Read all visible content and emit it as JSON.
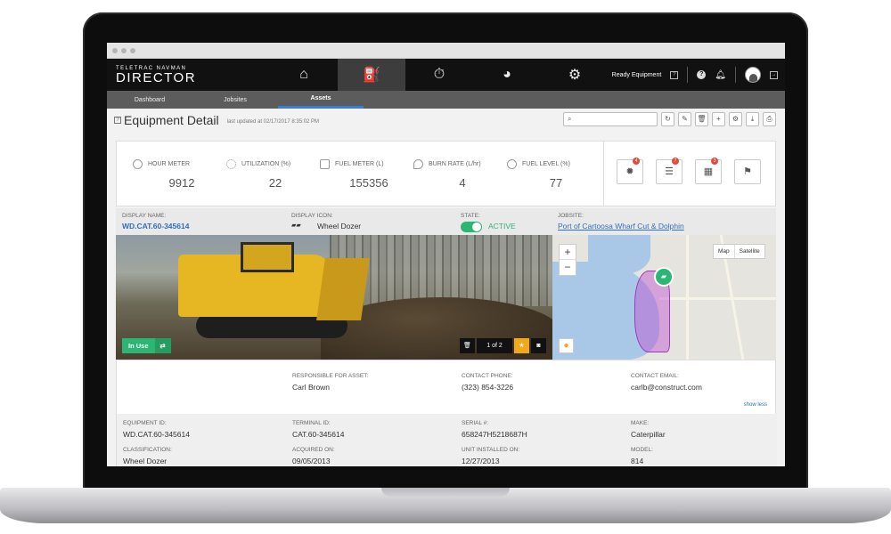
{
  "brand": {
    "small": "TELETRAC NAVMAN",
    "big": "DIRECTOR"
  },
  "topnav": {
    "icons": [
      "home-icon",
      "assets-icon",
      "stopwatch-icon",
      "pie-chart-icon",
      "gears-icon"
    ],
    "account_label": "Ready Equipment"
  },
  "subnav": {
    "tabs": [
      "Dashboard",
      "Jobsites",
      "Assets"
    ],
    "active": "Assets"
  },
  "header": {
    "title": "Equipment Detail",
    "updated": "last updated at 02/17/2017 8:35:02 PM"
  },
  "metrics": [
    {
      "label": "HOUR METER",
      "value": "9912",
      "icon": "gauge-icon"
    },
    {
      "label": "UTILIZATION (%)",
      "value": "22",
      "icon": "spinner-icon"
    },
    {
      "label": "FUEL METER (L)",
      "value": "155356",
      "icon": "fuel-pump-icon"
    },
    {
      "label": "BURN RATE (L/hr)",
      "value": "4",
      "icon": "flame-icon"
    },
    {
      "label": "FUEL LEVEL (%)",
      "value": "77",
      "icon": "fuel-gauge-icon"
    }
  ],
  "alerts": [
    {
      "icon": "engine-alert-icon",
      "count": "4"
    },
    {
      "icon": "document-alert-icon",
      "count": "7"
    },
    {
      "icon": "calendar-alert-icon",
      "count": "3"
    },
    {
      "icon": "flag-icon",
      "count": ""
    }
  ],
  "info": {
    "display_name_label": "DISPLAY NAME:",
    "display_name": "WD.CAT.60-345614",
    "display_icon_label": "DISPLAY ICON:",
    "display_icon": "Wheel Dozer",
    "state_label": "STATE:",
    "state": "ACTIVE",
    "jobsite_label": "JOBSITE:",
    "jobsite": "Port of Cartoosa Wharf Cut & Dolphin"
  },
  "photo": {
    "status": "In Use",
    "pager": "1 of 2"
  },
  "map": {
    "map_btn": "Map",
    "satellite_btn": "Satellite",
    "zoom_in": "+",
    "zoom_out": "−"
  },
  "details": {
    "responsible_label": "RESPONSIBLE FOR ASSET:",
    "responsible": "Carl Brown",
    "phone_label": "CONTACT PHONE:",
    "phone": "(323) 854-3226",
    "email_label": "CONTACT EMAIL:",
    "email": "carlb@construct.com",
    "show_less": "show less",
    "equipment_id_label": "EQUIPMENT ID:",
    "equipment_id": "WD.CAT.60-345614",
    "terminal_id_label": "TERMINAL ID:",
    "terminal_id": "CAT.60-345614",
    "serial_label": "SERIAL #:",
    "serial": "658247H5218687H",
    "make_label": "MAKE:",
    "make": "Caterpillar",
    "classification_label": "CLASSIFICATION:",
    "classification": "Wheel Dozer",
    "acquired_label": "ACQUIRED ON:",
    "acquired": "09/05/2013",
    "installed_label": "UNIT INSTALLED ON:",
    "installed": "12/27/2013",
    "model_label": "MODEL:",
    "model": "814"
  },
  "colors": {
    "accent": "#2f6fc1",
    "success": "#2bb673",
    "nav_bg": "#111111",
    "alert": "#e14b3b"
  }
}
